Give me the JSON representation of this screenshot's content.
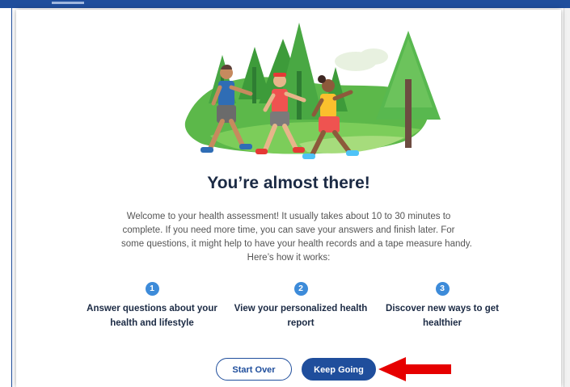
{
  "modal": {
    "title": "You’re almost there!",
    "intro_lines": [
      "Welcome to your health assessment! It usually takes about 10 to 30 minutes to",
      "complete. If you need more time, you can save your answers and finish later. For",
      "some questions, it might help to have your health records and a tape measure handy.",
      "Here’s how it works:"
    ],
    "steps": [
      {
        "number": "1",
        "line1": "Answer questions about your",
        "line2": "health and lifestyle"
      },
      {
        "number": "2",
        "line1": "View your personalized health",
        "line2": "report"
      },
      {
        "number": "3",
        "line1": "Discover new ways to get",
        "line2": "healthier"
      }
    ],
    "buttons": {
      "start_over": "Start Over",
      "keep_going": "Keep Going"
    }
  },
  "colors": {
    "primary": "#1f4e9c",
    "step_badge": "#3d8bd9",
    "annotation_arrow": "#e60000",
    "hero_green": "#4caf50"
  },
  "icons": [
    "walkers-illustration",
    "red-arrow-icon"
  ]
}
